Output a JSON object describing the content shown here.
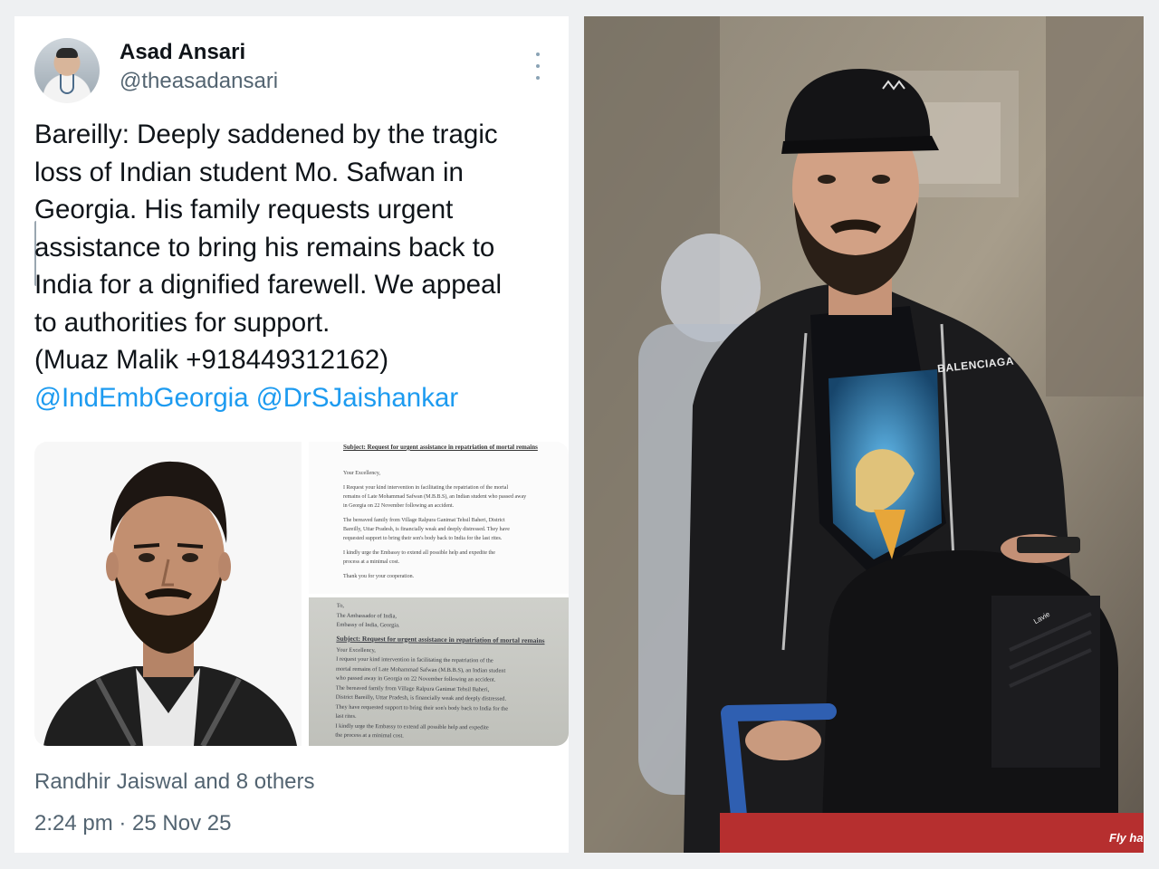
{
  "tweet": {
    "author_name": "Asad Ansari",
    "author_handle": "@theasadansari",
    "text_lines": [
      "Bareilly: Deeply saddened by the tragic",
      "loss of Indian student Mo. Safwan in",
      "Georgia. His family requests urgent",
      "assistance to bring his remains back to",
      "India for a dignified farewell. We appeal",
      "to authorities for support.",
      "(Muaz Malik +918449312162)"
    ],
    "mentions": [
      "@IndEmbGeorgia",
      "@DrSJaishankar"
    ],
    "engagement": "Randhir Jaiswal and 8 others",
    "timestamp": "2:24 pm · 25 Nov 25"
  },
  "letter_scan": {
    "subject": "Subject: Request for urgent assistance in repatriation of mortal remains",
    "lines": [
      "Your Excellency,",
      "I Request your kind intervention in facilitating the repatriation of the mortal",
      "remains of Late Mohammad Safwan (M.B.B.S), an Indian student who passed away",
      "in Georgia on 22 November following an accident.",
      "The bereaved family from Village Ralpura Ganimat Tehsil Baheri, District",
      "Bareilly, Uttar Pradesh, is financially weak and deeply distressed. They have",
      "requested support to bring their son's body back to India for the last rites.",
      "I kindly urge the Embassy to extend all possible help and expedite the",
      "process at a minimal cost.",
      "Thank you for your cooperation."
    ]
  },
  "letter_photo": {
    "address_lines": [
      "To,",
      "The Ambassador of India,",
      "Embassy of India, Georgia."
    ],
    "subject": "Subject: Request for urgent assistance in repatriation of mortal remains",
    "lines": [
      "Your Excellency,",
      "I request your kind intervention in facilitating the repatriation of the",
      "mortal remains of Late Mohammad Safwan (M.B.B.S), an Indian student",
      "who passed away in Georgia on 22 November following an accident.",
      "The bereaved family from Village Ralpura Ganimat Tehsil Baheri,",
      "District Bareilly, Uttar Pradesh, is financially weak and deeply distressed.",
      "They have requested support to bring their son's body back to India for the",
      "last rites.",
      "I kindly urge the Embassy to extend all possible help and expedite",
      "the process at a minimal cost."
    ]
  },
  "photo": {
    "jacket_brand": "BALENCIAGA",
    "bag_brand": "Lavie",
    "cart_text": "Fly ha"
  },
  "colors": {
    "link": "#1d9bf0",
    "text_primary": "#0f1419",
    "text_secondary": "#536471"
  },
  "icons": {
    "more": "vertical-dots-icon"
  }
}
